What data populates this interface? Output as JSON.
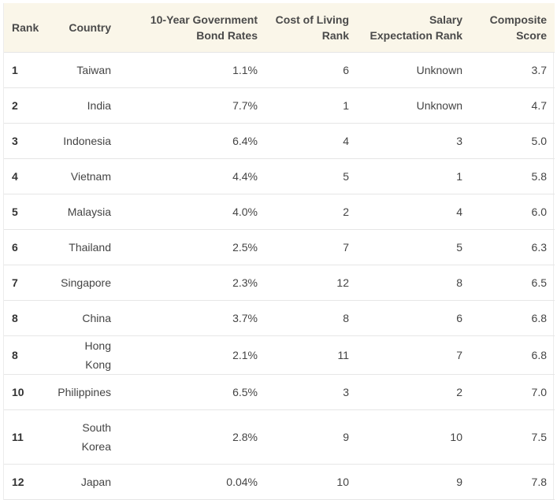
{
  "table": {
    "headers": [
      [
        "Rank"
      ],
      [
        "Country"
      ],
      [
        "10-Year Government",
        "Bond Rates"
      ],
      [
        "Cost of Living",
        "Rank"
      ],
      [
        "Salary",
        "Expectation Rank"
      ],
      [
        "Composite",
        "Score"
      ]
    ],
    "rows": [
      [
        "1",
        "Taiwan",
        "1.1%",
        "6",
        "Unknown",
        "3.7"
      ],
      [
        "2",
        "India",
        "7.7%",
        "1",
        "Unknown",
        "4.7"
      ],
      [
        "3",
        "Indonesia",
        "6.4%",
        "4",
        "3",
        "5.0"
      ],
      [
        "4",
        "Vietnam",
        "4.4%",
        "5",
        "1",
        "5.8"
      ],
      [
        "5",
        "Malaysia",
        "4.0%",
        "2",
        "4",
        "6.0"
      ],
      [
        "6",
        "Thailand",
        "2.5%",
        "7",
        "5",
        "6.3"
      ],
      [
        "7",
        "Singapore",
        "2.3%",
        "12",
        "8",
        "6.5"
      ],
      [
        "8",
        "China",
        "3.7%",
        "8",
        "6",
        "6.8"
      ],
      [
        "8",
        "Hong Kong",
        "2.1%",
        "11",
        "7",
        "6.8"
      ],
      [
        "10",
        "Philippines",
        "6.5%",
        "3",
        "2",
        "7.0"
      ],
      [
        "11",
        "South Korea",
        "2.8%",
        "9",
        "10",
        "7.5"
      ],
      [
        "12",
        "Japan",
        "0.04%",
        "10",
        "9",
        "7.8"
      ]
    ]
  }
}
